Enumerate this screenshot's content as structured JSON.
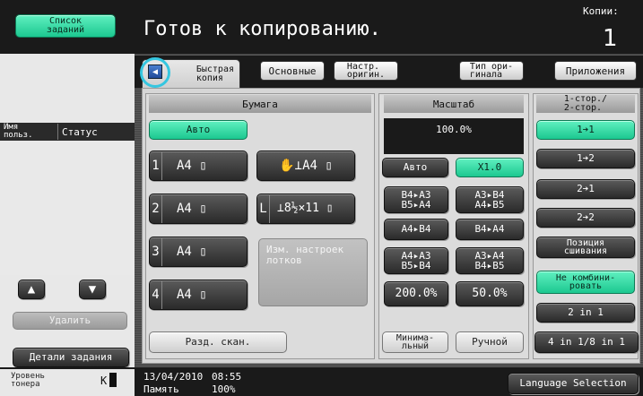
{
  "left": {
    "job_list_label": "Список\nзаданий",
    "user_label": "Имя\nпольз.",
    "status_label": "Статус",
    "delete_label": "Удалить",
    "job_details_label": "Детали задания",
    "toner_label": "Уровень\nтонера",
    "toner_value": "K"
  },
  "header": {
    "title": "Готов к копированию.",
    "copies_label": "Копии:",
    "copies_value": "1"
  },
  "tabs": [
    {
      "label": "Быстрая\nкопия"
    },
    {
      "label": "Основные"
    },
    {
      "label": "Настр.\nоригин."
    },
    {
      "label": "Тип ори-\nгинала"
    },
    {
      "label": "Приложения"
    }
  ],
  "paper": {
    "heading": "Бумага",
    "auto_label": "Авто",
    "trays": [
      {
        "num": "1",
        "label": "A4 ▯"
      },
      {
        "num": "2",
        "label": "A4 ▯"
      },
      {
        "num": "3",
        "label": "A4 ▯"
      },
      {
        "num": "4",
        "label": "A4 ▯"
      }
    ],
    "bypass_label": "✋⊥A4 ▯",
    "large_tray_num": "L",
    "large_tray_label": "⊥8½×11 ▯",
    "change_tray_label": "Изм. настроек\nлотков",
    "separate_scan_label": "Разд. скан."
  },
  "zoom": {
    "heading": "Масштаб",
    "value": "100.0%",
    "auto_label": "Авто",
    "x1_label": "X1.0",
    "presets": [
      "B4▸A3\nB5▸A4",
      "A3▸B4\nA4▸B5",
      "A4▸B4",
      "B4▸A4",
      "A4▸A3\nB5▸B4",
      "A3▸A4\nB4▸B5"
    ],
    "p200": "200.0%",
    "p50": "50.0%",
    "minimal_label": "Минима-\nльный",
    "manual_label": "Ручной"
  },
  "duplex": {
    "heading": "1-стор./\n2-стор.",
    "options": [
      "1➔1",
      "1➔2",
      "2➔1",
      "2➔2"
    ],
    "binding_label": "Позиция\nсшивания",
    "no_combine_label": "Не комбини-\nровать",
    "two_in_one": "2 in 1",
    "four_in_one": "4 in 1/8 in 1"
  },
  "status": {
    "date": "13/04/2010",
    "time": "08:55",
    "memory_label": "Память",
    "memory_value": "100%",
    "language_label": "Language Selection"
  },
  "colors": {
    "accent_green": "#1cc890",
    "highlight_ring": "#35c6e0",
    "dark_bg": "#1a1a1a"
  }
}
